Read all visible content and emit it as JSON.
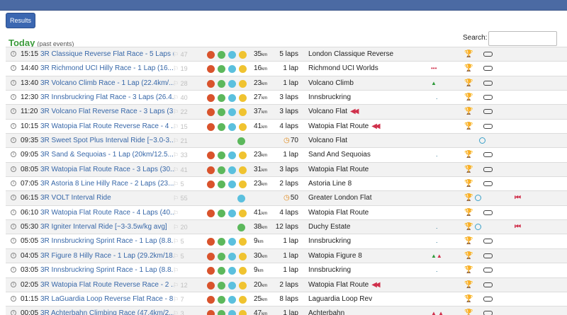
{
  "header": {
    "results_button": "Results"
  },
  "section": {
    "title": "Today",
    "subtitle": "(past events)"
  },
  "search": {
    "label": "Search:",
    "value": ""
  },
  "rows": [
    {
      "time": "15:15",
      "name": "3R Classique Reverse Flat Race - 5 Laps (...",
      "entrants": "47",
      "cats": "RGBY",
      "distance": "35",
      "laps": "5 laps",
      "route": "London Classique Reverse",
      "reverse": false,
      "tri": "",
      "trophy": true,
      "pill": true
    },
    {
      "time": "14:40",
      "name": "3R Richmond UCI Hilly Race - 1 Lap (16....",
      "entrants": "19",
      "cats": "RGBY",
      "distance": "16",
      "laps": "1 lap",
      "route": "Richmond UCI Worlds",
      "reverse": false,
      "tri": "red",
      "trophy": true,
      "pill": true
    },
    {
      "time": "13:40",
      "name": "3R Volcano Climb Race - 1 Lap (22.4km/...",
      "entrants": "28",
      "cats": "RGBY",
      "distance": "23",
      "laps": "1 lap",
      "route": "Volcano Climb",
      "reverse": false,
      "tri": "green",
      "trophy": true,
      "pill": true
    },
    {
      "time": "12:30",
      "name": "3R Innsbruckring Flat Race - 3 Laps (26.4...",
      "entrants": "40",
      "cats": "RGBY",
      "distance": "27",
      "laps": "3 laps",
      "route": "Innsbruckring",
      "reverse": false,
      "tri": "dash",
      "trophy": true,
      "pill": true
    },
    {
      "time": "11:20",
      "name": "3R Volcano Flat Reverse Race - 3 Laps (3...",
      "entrants": "22",
      "cats": "RGBY",
      "distance": "37",
      "laps": "3 laps",
      "route": "Volcano Flat",
      "reverse": true,
      "tri": "",
      "trophy": true,
      "pill": true
    },
    {
      "time": "10:15",
      "name": "3R Watopia Flat Route Reverse Race - 4 ...",
      "entrants": "15",
      "cats": "RGBY",
      "distance": "41",
      "laps": "4 laps",
      "route": "Watopia Flat Route",
      "reverse": true,
      "tri": "",
      "trophy": true,
      "pill": true
    },
    {
      "time": "09:35",
      "name": "3R Sweet Spot Plus Interval Ride [~3.0-3....",
      "entrants": "21",
      "cats": "G",
      "distance": "",
      "laps": "70",
      "clock": true,
      "route": "Volcano Flat",
      "reverse": false,
      "tri": "",
      "trophy": false,
      "ring": true
    },
    {
      "time": "09:05",
      "name": "3R Sand & Sequoias - 1 Lap (20km/12.5...",
      "entrants": "33",
      "cats": "RGBY",
      "distance": "23",
      "laps": "1 lap",
      "route": "Sand And Sequoias",
      "reverse": false,
      "tri": "dash",
      "trophy": true,
      "pill": true
    },
    {
      "time": "08:05",
      "name": "3R Watopia Flat Route Race - 3 Laps (30....",
      "entrants": "41",
      "cats": "RGBY",
      "distance": "31",
      "laps": "3 laps",
      "route": "Watopia Flat Route",
      "reverse": false,
      "tri": "",
      "trophy": true,
      "pill": true
    },
    {
      "time": "07:05",
      "name": "3R Astoria 8 Line Hilly Race - 2 Laps (23....",
      "entrants": "5",
      "cats": "RGBY",
      "distance": "23",
      "laps": "2 laps",
      "route": "Astoria Line 8",
      "reverse": false,
      "tri": "",
      "trophy": true,
      "pill": true
    },
    {
      "time": "06:15",
      "name": "3R VOLT Interval Ride",
      "entrants": "55",
      "cats": "B",
      "distance": "",
      "laps": "50",
      "clock": true,
      "route": "Greater London Flat",
      "reverse": false,
      "tri": "",
      "trophy": true,
      "ring": true,
      "bookmark": true
    },
    {
      "time": "06:10",
      "name": "3R Watopia Flat Route Race - 4 Laps (40....",
      "entrants": "",
      "cats": "RGBY",
      "distance": "41",
      "laps": "4 laps",
      "route": "Watopia Flat Route",
      "reverse": false,
      "tri": "",
      "trophy": true,
      "pill": true
    },
    {
      "time": "05:30",
      "name": "3R Igniter Interval Ride [~3-3.5w/kg avg]",
      "entrants": "20",
      "cats": "G",
      "distance": "38",
      "laps": "12 laps",
      "route": "Duchy Estate",
      "reverse": false,
      "tri": "dash",
      "trophy": true,
      "ring": true,
      "bookmark": true
    },
    {
      "time": "05:05",
      "name": "3R Innsbruckring Sprint Race - 1 Lap (8.8...",
      "entrants": "5",
      "cats": "RGBY",
      "distance": "9",
      "laps": "1 lap",
      "route": "Innsbruckring",
      "reverse": false,
      "tri": "dash",
      "trophy": true,
      "pill": true
    },
    {
      "time": "04:05",
      "name": "3R Figure 8 Hilly Race - 1 Lap (29.2km/18....",
      "entrants": "5",
      "cats": "RGBY",
      "distance": "30",
      "laps": "1 lap",
      "route": "Watopia Figure 8",
      "reverse": false,
      "tri": "greenred",
      "trophy": true,
      "pill": true
    },
    {
      "time": "03:05",
      "name": "3R Innsbruckring Sprint Race - 1 Lap (8.8...",
      "entrants": "",
      "cats": "RGBY",
      "distance": "9",
      "laps": "1 lap",
      "route": "Innsbruckring",
      "reverse": false,
      "tri": "dash",
      "trophy": true,
      "pill": true
    },
    {
      "time": "02:05",
      "name": "3R Watopia Flat Route Reverse Race - 2 ...",
      "entrants": "12",
      "cats": "RGBY",
      "distance": "20",
      "laps": "2 laps",
      "route": "Watopia Flat Route",
      "reverse": true,
      "tri": "",
      "trophy": true,
      "pill": true
    },
    {
      "time": "01:15",
      "name": "3R LaGuardia Loop Reverse Flat Race - 8 ...",
      "entrants": "7",
      "cats": "RGBY",
      "distance": "25",
      "laps": "8 laps",
      "route": "Laguardia Loop Rev",
      "reverse": false,
      "tri": "",
      "trophy": true,
      "pill": true
    },
    {
      "time": "00:05",
      "name": "3R Achterbahn Climbing Race (47.4km/2...",
      "entrants": "3",
      "cats": "RGBY",
      "distance": "47",
      "laps": "1 lap",
      "route": "Achterbahn",
      "reverse": false,
      "tri": "redred",
      "trophy": true,
      "pill": true
    }
  ],
  "colors": {
    "topbar": "#4b6aa3",
    "link": "#3767a8",
    "today": "#3a9a3a",
    "reverse_arrow": "#d0314c"
  },
  "icons": {
    "info": "info-icon",
    "flag": "flag-icon",
    "trophy": "trophy-icon",
    "reverse": "reverse-arrow-icon",
    "clock": "clock-icon",
    "bookmark": "bookmark-icon"
  }
}
